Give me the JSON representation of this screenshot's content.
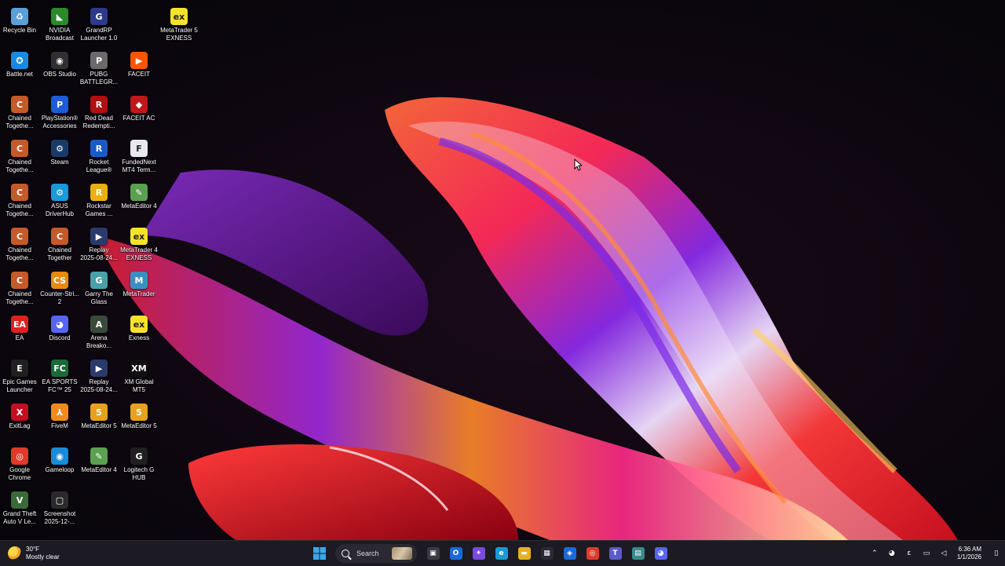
{
  "desktop": {
    "icons": [
      {
        "label": "Recycle Bin",
        "icon": "recycle-bin-icon",
        "color": "#5aa0d8",
        "glyph": "♻"
      },
      {
        "label": "NVIDIA\nBroadcast",
        "icon": "nvidia-broadcast-icon",
        "color": "#2a8a2a",
        "glyph": "◣"
      },
      {
        "label": "GrandRP\nLauncher 1.0",
        "icon": "grandrp-icon",
        "color": "#2d3a8a",
        "glyph": "G"
      },
      {
        "label": "MetaTrader 5\nEXNESS",
        "icon": "metatrader5-exness-icon",
        "color": "#f4e22c",
        "glyph": "ex"
      },
      {
        "label": "Battle.net",
        "icon": "battlenet-icon",
        "color": "#1a8ae0",
        "glyph": "✪"
      },
      {
        "label": "OBS Studio",
        "icon": "obs-icon",
        "color": "#303030",
        "glyph": "◉"
      },
      {
        "label": "PUBG\nBATTLEGR...",
        "icon": "pubg-icon",
        "color": "#6a6a6a",
        "glyph": "P"
      },
      {
        "label": "FACEIT",
        "icon": "faceit-icon",
        "color": "#ff5500",
        "glyph": "▶"
      },
      {
        "label": "Chained\nTogethe...",
        "icon": "chained-together-icon",
        "color": "#c45a2a",
        "glyph": "C"
      },
      {
        "label": "PlayStation®\nAccessories",
        "icon": "playstation-icon",
        "color": "#1e5bd6",
        "glyph": "P"
      },
      {
        "label": "Red Dead\nRedempti...",
        "icon": "red-dead-icon",
        "color": "#b01010",
        "glyph": "R"
      },
      {
        "label": "FACEIT AC",
        "icon": "faceit-ac-icon",
        "color": "#c01818",
        "glyph": "◆"
      },
      {
        "label": "Chained\nTogethe...",
        "icon": "chained-together-icon",
        "color": "#c45a2a",
        "glyph": "C"
      },
      {
        "label": "Steam",
        "icon": "steam-icon",
        "color": "#1a3a6a",
        "glyph": "⚙"
      },
      {
        "label": "Rocket\nLeague®",
        "icon": "rocket-league-icon",
        "color": "#1a5ac8",
        "glyph": "R"
      },
      {
        "label": "FundedNext\nMT4 Term...",
        "icon": "fundednext-icon",
        "color": "#e8e8f0",
        "glyph": "F"
      },
      {
        "label": "Chained\nTogethe...",
        "icon": "chained-together-icon",
        "color": "#c45a2a",
        "glyph": "C"
      },
      {
        "label": "ASUS\nDriverHub",
        "icon": "asus-driverhub-icon",
        "color": "#1a9ad8",
        "glyph": "⚙"
      },
      {
        "label": "Rockstar\nGames ...",
        "icon": "rockstar-icon",
        "color": "#e8b010",
        "glyph": "R"
      },
      {
        "label": "MetaEditor 4",
        "icon": "metaeditor4-icon",
        "color": "#5aa050",
        "glyph": "✎"
      },
      {
        "label": "Chained\nTogethe...",
        "icon": "chained-together-icon",
        "color": "#c45a2a",
        "glyph": "C"
      },
      {
        "label": "Chained\nTogether",
        "icon": "chained-together-icon",
        "color": "#c45a2a",
        "glyph": "C"
      },
      {
        "label": "Replay\n2025-08-24...",
        "icon": "video-file-icon",
        "color": "#2a3a6a",
        "glyph": "▶"
      },
      {
        "label": "MetaTrader 4\nEXNESS",
        "icon": "metatrader4-exness-icon",
        "color": "#f4e22c",
        "glyph": "ex"
      },
      {
        "label": "Chained\nTogethe...",
        "icon": "chained-together-icon",
        "color": "#c45a2a",
        "glyph": "C"
      },
      {
        "label": "Counter-Stri...\n2",
        "icon": "counter-strike-icon",
        "color": "#e88a10",
        "glyph": "CS"
      },
      {
        "label": "Garry The\nGlass",
        "icon": "garry-glass-icon",
        "color": "#4aa0a8",
        "glyph": "G"
      },
      {
        "label": "MetaTrader",
        "icon": "metatrader-icon",
        "color": "#3a90c0",
        "glyph": "M"
      },
      {
        "label": "EA",
        "icon": "ea-icon",
        "color": "#e02020",
        "glyph": "EA"
      },
      {
        "label": "Discord",
        "icon": "discord-icon",
        "color": "#5865f2",
        "glyph": "◕"
      },
      {
        "label": "Arena\nBreako...",
        "icon": "arena-breakout-icon",
        "color": "#3a4a3a",
        "glyph": "A"
      },
      {
        "label": "Exness",
        "icon": "exness-icon",
        "color": "#f4e22c",
        "glyph": "ex"
      },
      {
        "label": "Epic Games\nLauncher",
        "icon": "epic-games-icon",
        "color": "#202020",
        "glyph": "E"
      },
      {
        "label": "EA SPORTS\nFC™ 25",
        "icon": "ea-fc-icon",
        "color": "#1a6a3a",
        "glyph": "FC"
      },
      {
        "label": "Replay\n2025-08-24...",
        "icon": "video-file-icon",
        "color": "#2a3a6a",
        "glyph": "▶"
      },
      {
        "label": "XM Global\nMT5",
        "icon": "xm-icon",
        "color": "#101010",
        "glyph": "XM"
      },
      {
        "label": "ExitLag",
        "icon": "exitlag-icon",
        "color": "#c01020",
        "glyph": "X"
      },
      {
        "label": "FiveM",
        "icon": "fivem-icon",
        "color": "#f08a20",
        "glyph": "⅄"
      },
      {
        "label": "MetaEditor 5",
        "icon": "metaeditor5-icon",
        "color": "#e8a020",
        "glyph": "5"
      },
      {
        "label": "MetaEditor 5",
        "icon": "metaeditor5-icon",
        "color": "#e8a020",
        "glyph": "5"
      },
      {
        "label": "Google\nChrome",
        "icon": "chrome-icon",
        "color": "#e03a2a",
        "glyph": "◎"
      },
      {
        "label": "Gameloop",
        "icon": "gameloop-icon",
        "color": "#1a8ad8",
        "glyph": "◉"
      },
      {
        "label": "MetaEditor 4",
        "icon": "metaeditor4-icon",
        "color": "#5aa050",
        "glyph": "✎"
      },
      {
        "label": "Logitech G\nHUB",
        "icon": "logitech-ghub-icon",
        "color": "#202020",
        "glyph": "G"
      },
      {
        "label": "Grand Theft\nAuto V Le...",
        "icon": "gta5-icon",
        "color": "#3a6a3a",
        "glyph": "V"
      },
      {
        "label": "Screenshot\n2025-12-...",
        "icon": "image-file-icon",
        "color": "#2a2a2a",
        "glyph": "▢"
      }
    ]
  },
  "taskbar": {
    "weather": {
      "temp": "30°F",
      "condition": "Mostly clear"
    },
    "search_label": "Search",
    "apps": [
      {
        "icon": "task-view-icon",
        "color": "#3a3a44",
        "glyph": "▣"
      },
      {
        "icon": "outlook-icon",
        "color": "#1a6ad8",
        "glyph": "O"
      },
      {
        "icon": "copilot-icon",
        "color": "#7a4ae0",
        "glyph": "✦"
      },
      {
        "icon": "edge-icon",
        "color": "#1a9ad0",
        "glyph": "e"
      },
      {
        "icon": "file-explorer-icon",
        "color": "#e8b020",
        "glyph": "▬"
      },
      {
        "icon": "microsoft-store-icon",
        "color": "#2a2a34",
        "glyph": "▦"
      },
      {
        "icon": "defender-icon",
        "color": "#1a6ad8",
        "glyph": "◈"
      },
      {
        "icon": "chrome-taskbar-icon",
        "color": "#e03a2a",
        "glyph": "◎"
      },
      {
        "icon": "teams-icon",
        "color": "#5a5ac8",
        "glyph": "T"
      },
      {
        "icon": "calculator-icon",
        "color": "#3a8a8a",
        "glyph": "▤"
      },
      {
        "icon": "discord-taskbar-icon",
        "color": "#5865f2",
        "glyph": "◕"
      }
    ],
    "tray": {
      "chevron": "⌃",
      "discord": "◕",
      "lang": "ε",
      "network": "▭",
      "volume": "◁",
      "time": "6:36 AM",
      "date": "1/1/2026",
      "notif": "▯"
    }
  }
}
